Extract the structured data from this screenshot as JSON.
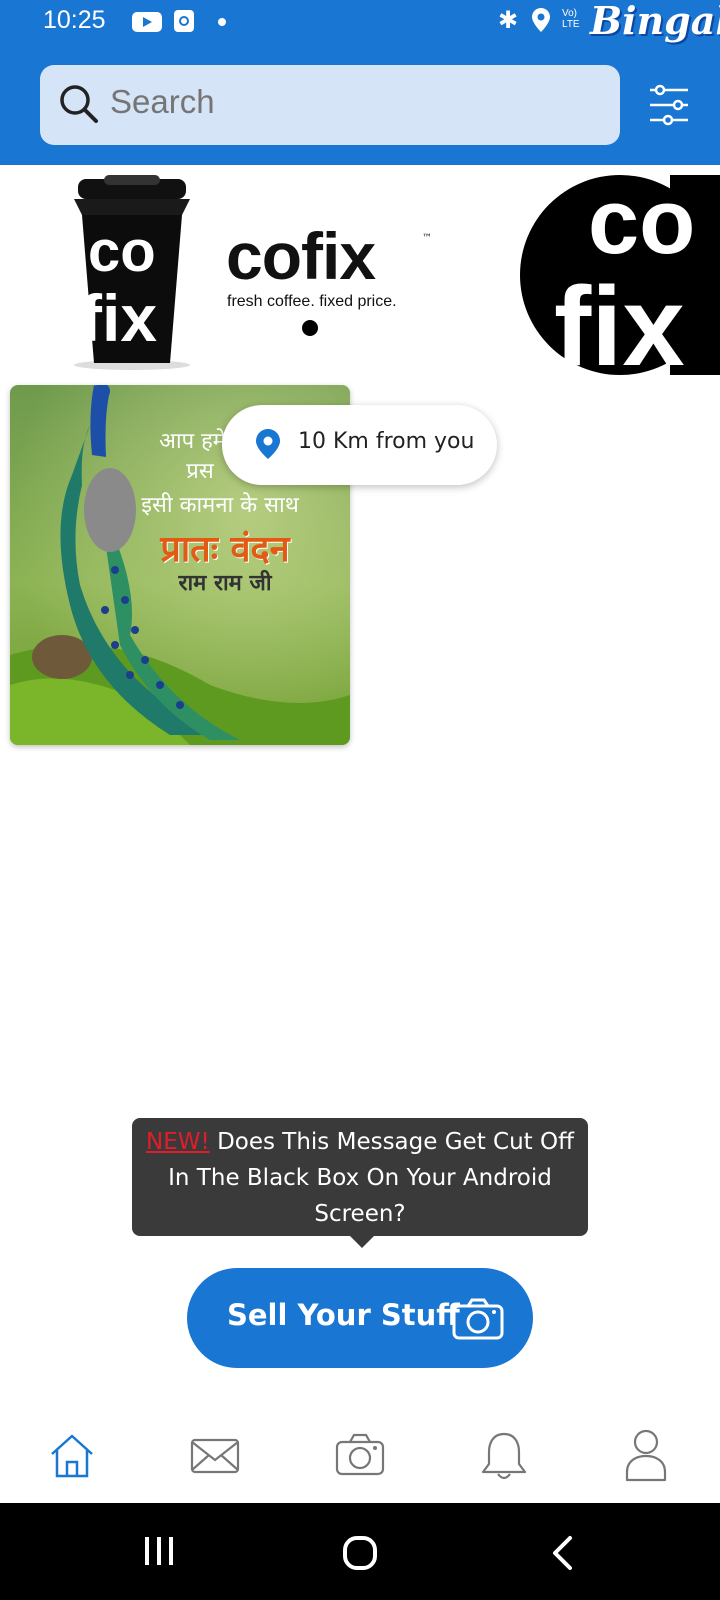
{
  "status_bar": {
    "time": "10:25",
    "lte_label": "Vo)\nLTE",
    "brand_watermark": "Bingalo",
    "icons": [
      "youtube-icon",
      "calendar-icon",
      "notification-dot",
      "bluetooth-icon",
      "location-icon"
    ]
  },
  "search": {
    "placeholder": "Search",
    "icon": "search-icon",
    "filter_icon": "filter-sliders-icon"
  },
  "banner": {
    "brand": "cofix",
    "tagline": "fresh coffee. fixed price."
  },
  "listing": {
    "image_text_line1": "आप हमेश",
    "image_text_line2": "प्रस",
    "image_text_line3": "इसी कामना के साथ",
    "image_text_line4": "प्रातः वंदन",
    "image_text_line5": "राम राम जी",
    "distance": "10 Km from you"
  },
  "tooltip": {
    "new_label": "NEW!",
    "message": "Does This Message Get Cut Off In The Black Box On Your Android Screen?"
  },
  "sell_button": {
    "label": "Sell Your Stuff"
  },
  "bottom_nav": {
    "items": [
      "home-icon",
      "messages-icon",
      "camera-icon",
      "notifications-icon",
      "profile-icon"
    ]
  },
  "colors": {
    "primary": "#1976d2",
    "search_bg": "#d5e4f7",
    "tooltip_bg": "#3a3a3a",
    "new_red": "#e21d2a"
  }
}
